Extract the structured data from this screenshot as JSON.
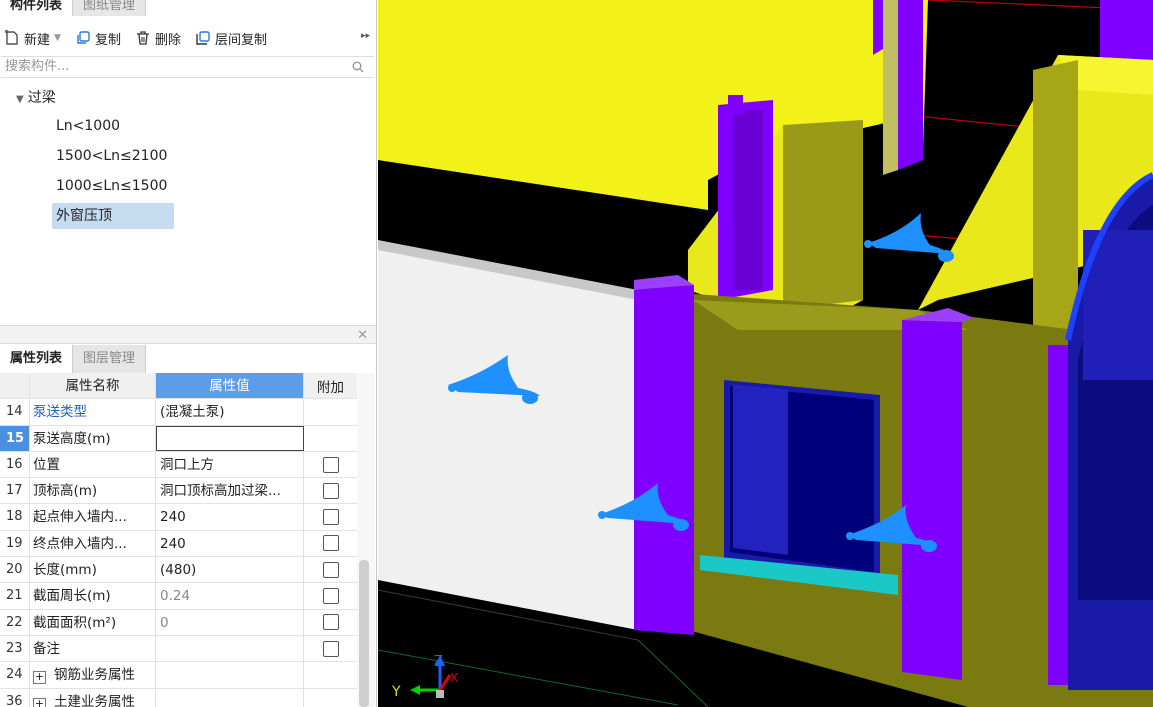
{
  "component_tabs": [
    "构件列表",
    "图纸管理"
  ],
  "toolbar": {
    "new_label": "新建",
    "copy_label": "复制",
    "delete_label": "删除",
    "floor_copy_label": "层间复制",
    "more_icon": "double-right-arrow"
  },
  "search": {
    "placeholder": "搜索构件..."
  },
  "tree": {
    "root": "过梁",
    "items": [
      "Ln<1000",
      "1500<Ln≤2100",
      "1000≤Ln≤1500",
      "外窗压顶"
    ],
    "selected_index": 3
  },
  "property_tabs": [
    "属性列表",
    "图层管理"
  ],
  "property_grid": {
    "headers": {
      "name": "属性名称",
      "value": "属性值",
      "extra": "附加"
    },
    "rows": [
      {
        "num": "14",
        "name": "泵送类型",
        "value": "(混凝土泵)",
        "checkbox": false,
        "link": true
      },
      {
        "num": "15",
        "name": "泵送高度(m)",
        "value": "",
        "checkbox": false,
        "selected": true
      },
      {
        "num": "16",
        "name": "位置",
        "value": "洞口上方",
        "checkbox": true
      },
      {
        "num": "17",
        "name": "顶标高(m)",
        "value": "洞口顶标高加过梁...",
        "checkbox": true
      },
      {
        "num": "18",
        "name": "起点伸入墙内...",
        "value": "240",
        "checkbox": true
      },
      {
        "num": "19",
        "name": "终点伸入墙内...",
        "value": "240",
        "checkbox": true
      },
      {
        "num": "20",
        "name": "长度(mm)",
        "value": "(480)",
        "checkbox": true
      },
      {
        "num": "21",
        "name": "截面周长(m)",
        "value": "0.24",
        "checkbox": true,
        "gray": true
      },
      {
        "num": "22",
        "name": "截面面积(m²)",
        "value": "0",
        "checkbox": true,
        "gray": true
      },
      {
        "num": "23",
        "name": "备注",
        "value": "",
        "checkbox": true
      },
      {
        "num": "24",
        "name": "钢筋业务属性",
        "value": "",
        "checkbox": false,
        "group": true
      },
      {
        "num": "36",
        "name": "土建业务属性",
        "value": "",
        "checkbox": false,
        "group": true
      }
    ]
  },
  "viewport": {
    "axis_labels": {
      "y": "Y",
      "z": "Z",
      "x": "X"
    },
    "colors": {
      "wall_yellow": "#f2f218",
      "wall_olive": "#7a7a10",
      "column_purple": "#8000ff",
      "glass_blue": "#1a1aa8",
      "marker_blue": "#1e90ff"
    }
  }
}
